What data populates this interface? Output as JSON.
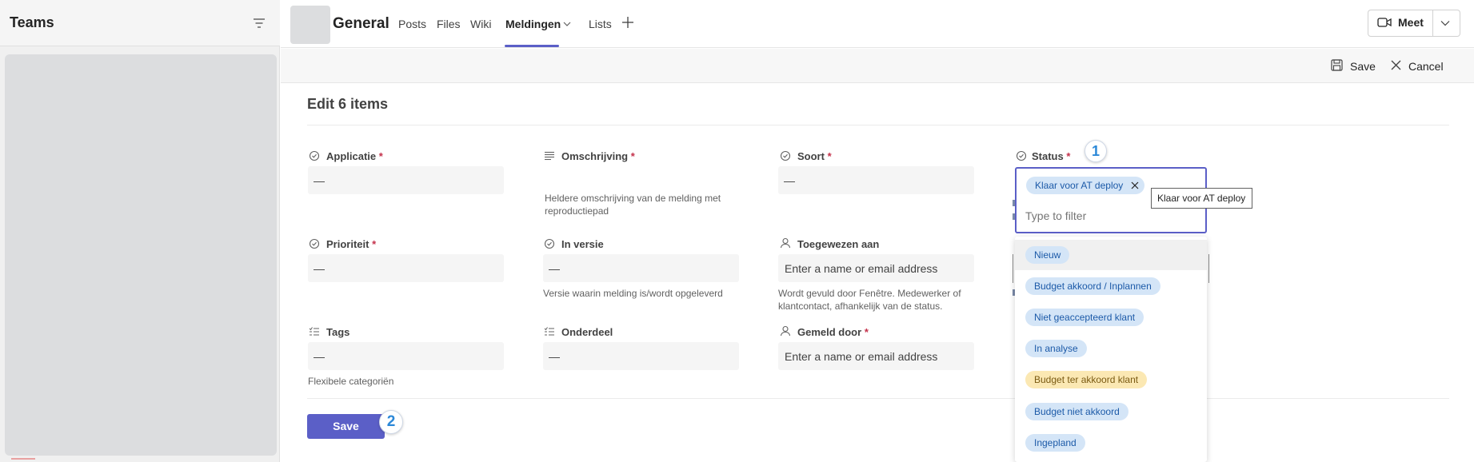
{
  "sidebar": {
    "title": "Teams"
  },
  "header": {
    "channel_name": "General",
    "tabs": [
      {
        "label": "Posts"
      },
      {
        "label": "Files"
      },
      {
        "label": "Wiki"
      },
      {
        "label": "Meldingen",
        "active": true
      },
      {
        "label": "Lists"
      }
    ],
    "meet_label": "Meet"
  },
  "command_bar": {
    "save_label": "Save",
    "cancel_label": "Cancel"
  },
  "form": {
    "title": "Edit 6 items",
    "required_mark": "*",
    "empty_value": "—",
    "people_placeholder": "Enter a name or email address",
    "fields": {
      "applicatie": {
        "label": "Applicatie",
        "required": true
      },
      "omschrijving": {
        "label": "Omschrijving",
        "required": true,
        "help": "Heldere omschrijving van de melding met reproductiepad"
      },
      "soort": {
        "label": "Soort",
        "required": true
      },
      "status": {
        "label": "Status",
        "required": true
      },
      "prioriteit": {
        "label": "Prioriteit",
        "required": true
      },
      "in_versie": {
        "label": "In versie",
        "help": "Versie waarin melding is/wordt opgeleverd"
      },
      "toegewezen_aan": {
        "label": "Toegewezen aan",
        "help": "Wordt gevuld door Fenêtre. Medewerker of klantcontact, afhankelijk van de status."
      },
      "tags": {
        "label": "Tags",
        "help": "Flexibele categoriën"
      },
      "onderdeel": {
        "label": "Onderdeel"
      },
      "gemeld_door": {
        "label": "Gemeld door",
        "required": true
      }
    },
    "save_button": "Save"
  },
  "status_picker": {
    "selected": "Klaar voor AT deploy",
    "filter_placeholder": "Type to filter",
    "tooltip": "Klaar voor AT deploy",
    "options": [
      {
        "label": "Nieuw",
        "color": "#d4e5f7"
      },
      {
        "label": "Budget akkoord / Inplannen",
        "color": "#d4e5f7"
      },
      {
        "label": "Niet geaccepteerd klant",
        "color": "#d4e5f7"
      },
      {
        "label": "In analyse",
        "color": "#d4e5f7"
      },
      {
        "label": "Budget ter akkoord klant",
        "color": "#fbe8b3"
      },
      {
        "label": "Budget niet akkoord",
        "color": "#d4e5f7"
      },
      {
        "label": "Ingepland",
        "color": "#d4e5f7"
      }
    ]
  },
  "callouts": {
    "badge_1": "1",
    "badge_2": "2"
  },
  "colors": {
    "accent": "#5b5fc7",
    "required": "#c4314b",
    "callout": "#2b88d8"
  }
}
